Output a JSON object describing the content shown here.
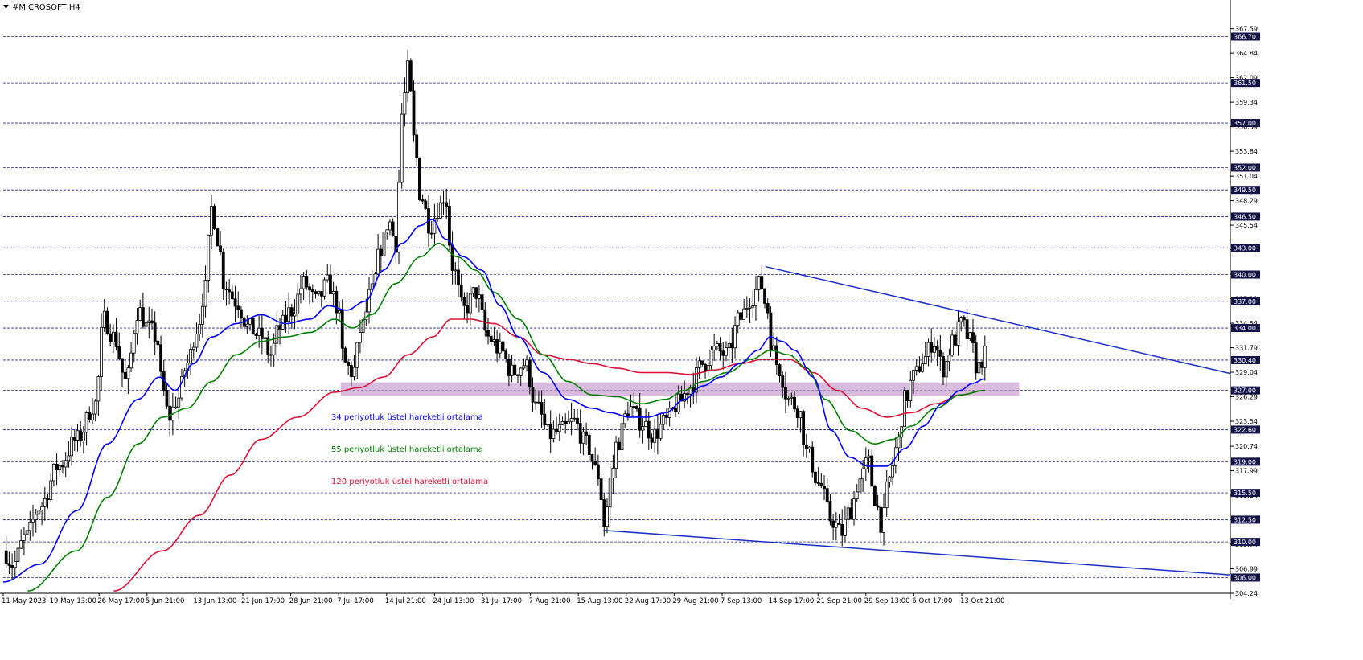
{
  "window": {
    "title": "#MICROSOFT,H4"
  },
  "colors": {
    "ema34": "#0000ff",
    "ema55": "#008000",
    "ema120": "#dd1133",
    "trendline": "#1a2fc8",
    "level": "#24248c",
    "zone": "#c9a0cf",
    "candle": "#000000"
  },
  "chart_data": {
    "type": "line",
    "symbol": "#MICROSOFT",
    "timeframe": "H4",
    "ylim": [
      304.24,
      369.0
    ],
    "price_ticks": [
      "367.59",
      "364.84",
      "362.09",
      "359.34",
      "356.59",
      "353.84",
      "351.04",
      "348.29",
      "345.54",
      "342.79",
      "340.04",
      "337.29",
      "334.54",
      "331.79",
      "329.04",
      "326.29",
      "323.54",
      "320.74",
      "317.99",
      "315.24",
      "312.49",
      "309.74",
      "306.99",
      "304.24"
    ],
    "levels": [
      366.7,
      361.5,
      357.0,
      352.0,
      349.5,
      346.5,
      343.0,
      340.0,
      337.0,
      334.0,
      330.4,
      327.0,
      322.6,
      319.0,
      315.5,
      312.5,
      310.0,
      306.0
    ],
    "level_labels": [
      "366.70",
      "361.50",
      "357.00",
      "352.00",
      "349.50",
      "346.50",
      "343.00",
      "340.00",
      "337.00",
      "334.00",
      "330.40",
      "327.00",
      "322.60",
      "319.00",
      "315.50",
      "312.50",
      "310.00",
      "306.00"
    ],
    "time_labels": [
      "11 May 2023",
      "19 May 13:00",
      "26 May 17:00",
      "5 Jun 21:00",
      "13 Jun 13:00",
      "21 Jun 17:00",
      "28 Jun 21:00",
      "7 Jul 17:00",
      "14 Jul 21:00",
      "24 Jul 13:00",
      "31 Jul 17:00",
      "7 Aug 21:00",
      "15 Aug 13:00",
      "22 Aug 17:00",
      "29 Aug 21:00",
      "7 Sep 13:00",
      "14 Sep 17:00",
      "21 Sep 21:00",
      "29 Sep 13:00",
      "6 Oct 17:00",
      "13 Oct 21:00"
    ],
    "support_zone": {
      "from": 326.4,
      "to": 327.9,
      "t_start": 0.275,
      "t_end": 0.828
    },
    "trendlines": [
      {
        "t": [
          0.621,
          1.0
        ],
        "y": [
          340.9,
          328.9
        ]
      },
      {
        "t": [
          0.489,
          1.0
        ],
        "y": [
          311.3,
          306.3
        ]
      }
    ],
    "price_anchors": [
      [
        0.0,
        309.0
      ],
      [
        0.008,
        307.5
      ],
      [
        0.018,
        310.5
      ],
      [
        0.03,
        314.0
      ],
      [
        0.045,
        318.5
      ],
      [
        0.06,
        321.5
      ],
      [
        0.075,
        325.5
      ],
      [
        0.082,
        335.0
      ],
      [
        0.09,
        333.0
      ],
      [
        0.1,
        328.0
      ],
      [
        0.11,
        336.0
      ],
      [
        0.118,
        334.0
      ],
      [
        0.125,
        333.0
      ],
      [
        0.13,
        327.0
      ],
      [
        0.135,
        324.0
      ],
      [
        0.142,
        326.0
      ],
      [
        0.15,
        330.0
      ],
      [
        0.158,
        334.0
      ],
      [
        0.164,
        338.0
      ],
      [
        0.17,
        347.5
      ],
      [
        0.175,
        344.0
      ],
      [
        0.18,
        339.0
      ],
      [
        0.19,
        337.0
      ],
      [
        0.2,
        334.0
      ],
      [
        0.21,
        333.0
      ],
      [
        0.218,
        331.0
      ],
      [
        0.225,
        334.0
      ],
      [
        0.235,
        336.0
      ],
      [
        0.245,
        339.0
      ],
      [
        0.255,
        337.0
      ],
      [
        0.265,
        339.0
      ],
      [
        0.272,
        336.5
      ],
      [
        0.278,
        330.0
      ],
      [
        0.285,
        329.0
      ],
      [
        0.292,
        334.0
      ],
      [
        0.3,
        338.0
      ],
      [
        0.308,
        343.0
      ],
      [
        0.314,
        346.0
      ],
      [
        0.32,
        343.5
      ],
      [
        0.325,
        358.0
      ],
      [
        0.33,
        363.0
      ],
      [
        0.335,
        355.0
      ],
      [
        0.34,
        349.0
      ],
      [
        0.348,
        345.5
      ],
      [
        0.355,
        347.5
      ],
      [
        0.36,
        349.0
      ],
      [
        0.366,
        341.0
      ],
      [
        0.375,
        336.0
      ],
      [
        0.385,
        338.0
      ],
      [
        0.395,
        333.0
      ],
      [
        0.405,
        331.5
      ],
      [
        0.415,
        329.0
      ],
      [
        0.425,
        330.0
      ],
      [
        0.435,
        325.0
      ],
      [
        0.445,
        322.0
      ],
      [
        0.455,
        322.5
      ],
      [
        0.465,
        323.5
      ],
      [
        0.475,
        321.0
      ],
      [
        0.485,
        317.5
      ],
      [
        0.49,
        312.0
      ],
      [
        0.495,
        317.0
      ],
      [
        0.5,
        321.0
      ],
      [
        0.51,
        325.0
      ],
      [
        0.52,
        323.5
      ],
      [
        0.53,
        322.0
      ],
      [
        0.54,
        323.5
      ],
      [
        0.55,
        325.5
      ],
      [
        0.56,
        327.5
      ],
      [
        0.57,
        330.0
      ],
      [
        0.58,
        331.5
      ],
      [
        0.59,
        331.0
      ],
      [
        0.6,
        335.0
      ],
      [
        0.61,
        337.5
      ],
      [
        0.617,
        339.0
      ],
      [
        0.622,
        336.5
      ],
      [
        0.627,
        331.5
      ],
      [
        0.632,
        329.5
      ],
      [
        0.64,
        326.0
      ],
      [
        0.648,
        325.0
      ],
      [
        0.655,
        320.0
      ],
      [
        0.665,
        316.5
      ],
      [
        0.675,
        312.5
      ],
      [
        0.683,
        311.0
      ],
      [
        0.69,
        313.5
      ],
      [
        0.698,
        317.0
      ],
      [
        0.705,
        319.0
      ],
      [
        0.71,
        315.0
      ],
      [
        0.716,
        312.0
      ],
      [
        0.722,
        317.0
      ],
      [
        0.728,
        320.5
      ],
      [
        0.735,
        326.0
      ],
      [
        0.742,
        328.5
      ],
      [
        0.75,
        330.5
      ],
      [
        0.758,
        332.5
      ],
      [
        0.766,
        329.5
      ],
      [
        0.774,
        332.5
      ],
      [
        0.781,
        334.5
      ],
      [
        0.788,
        332.5
      ],
      [
        0.794,
        329.5
      ],
      [
        0.8,
        331.0
      ]
    ],
    "ema_anchors": {
      "ema34": [
        [
          0.0,
          305.5
        ],
        [
          0.03,
          307.5
        ],
        [
          0.06,
          313.5
        ],
        [
          0.085,
          321.0
        ],
        [
          0.11,
          326.0
        ],
        [
          0.127,
          328.5
        ],
        [
          0.14,
          327.0
        ],
        [
          0.155,
          330.0
        ],
        [
          0.17,
          333.0
        ],
        [
          0.19,
          334.5
        ],
        [
          0.21,
          335.5
        ],
        [
          0.23,
          334.5
        ],
        [
          0.25,
          335.0
        ],
        [
          0.265,
          336.5
        ],
        [
          0.28,
          336.0
        ],
        [
          0.295,
          337.0
        ],
        [
          0.31,
          340.5
        ],
        [
          0.325,
          343.5
        ],
        [
          0.34,
          345.5
        ],
        [
          0.35,
          346.2
        ],
        [
          0.36,
          344.0
        ],
        [
          0.375,
          342.0
        ],
        [
          0.39,
          340.5
        ],
        [
          0.405,
          336.5
        ],
        [
          0.42,
          333.0
        ],
        [
          0.44,
          329.0
        ],
        [
          0.46,
          326.0
        ],
        [
          0.48,
          325.0
        ],
        [
          0.495,
          324.5
        ],
        [
          0.51,
          324.0
        ],
        [
          0.525,
          324.0
        ],
        [
          0.54,
          324.5
        ],
        [
          0.555,
          326.0
        ],
        [
          0.57,
          327.5
        ],
        [
          0.585,
          328.5
        ],
        [
          0.6,
          330.0
        ],
        [
          0.615,
          331.5
        ],
        [
          0.625,
          333.0
        ],
        [
          0.635,
          332.5
        ],
        [
          0.645,
          331.5
        ],
        [
          0.66,
          328.5
        ],
        [
          0.675,
          322.5
        ],
        [
          0.69,
          319.5
        ],
        [
          0.705,
          318.5
        ],
        [
          0.72,
          318.5
        ],
        [
          0.735,
          320.5
        ],
        [
          0.75,
          323.0
        ],
        [
          0.765,
          325.5
        ],
        [
          0.78,
          327.0
        ],
        [
          0.79,
          327.8
        ],
        [
          0.8,
          328.3
        ]
      ],
      "ema55": [
        [
          0.02,
          304.5
        ],
        [
          0.06,
          309.0
        ],
        [
          0.085,
          315.0
        ],
        [
          0.11,
          321.0
        ],
        [
          0.13,
          324.0
        ],
        [
          0.15,
          325.0
        ],
        [
          0.17,
          328.0
        ],
        [
          0.19,
          331.0
        ],
        [
          0.21,
          332.5
        ],
        [
          0.23,
          333.0
        ],
        [
          0.25,
          333.5
        ],
        [
          0.27,
          335.0
        ],
        [
          0.285,
          334.0
        ],
        [
          0.3,
          335.5
        ],
        [
          0.32,
          339.0
        ],
        [
          0.34,
          342.0
        ],
        [
          0.355,
          343.5
        ],
        [
          0.37,
          342.0
        ],
        [
          0.385,
          340.5
        ],
        [
          0.4,
          338.0
        ],
        [
          0.42,
          335.0
        ],
        [
          0.44,
          331.0
        ],
        [
          0.46,
          328.0
        ],
        [
          0.48,
          326.5
        ],
        [
          0.5,
          326.3
        ],
        [
          0.52,
          325.5
        ],
        [
          0.54,
          326.0
        ],
        [
          0.555,
          327.0
        ],
        [
          0.57,
          328.0
        ],
        [
          0.59,
          329.0
        ],
        [
          0.61,
          330.5
        ],
        [
          0.625,
          331.5
        ],
        [
          0.64,
          331.0
        ],
        [
          0.655,
          329.5
        ],
        [
          0.67,
          326.0
        ],
        [
          0.69,
          322.5
        ],
        [
          0.71,
          321.0
        ],
        [
          0.725,
          321.5
        ],
        [
          0.74,
          323.0
        ],
        [
          0.76,
          325.0
        ],
        [
          0.78,
          326.5
        ],
        [
          0.8,
          327.0
        ]
      ],
      "ema120": [
        [
          0.09,
          304.5
        ],
        [
          0.13,
          309.0
        ],
        [
          0.16,
          313.0
        ],
        [
          0.185,
          317.5
        ],
        [
          0.21,
          321.5
        ],
        [
          0.24,
          324.0
        ],
        [
          0.27,
          326.8
        ],
        [
          0.29,
          327.3
        ],
        [
          0.31,
          328.5
        ],
        [
          0.33,
          331.0
        ],
        [
          0.35,
          333.0
        ],
        [
          0.365,
          335.0
        ],
        [
          0.38,
          335.0
        ],
        [
          0.4,
          334.5
        ],
        [
          0.42,
          333.0
        ],
        [
          0.44,
          331.0
        ],
        [
          0.46,
          330.5
        ],
        [
          0.48,
          330.0
        ],
        [
          0.5,
          329.5
        ],
        [
          0.52,
          329.0
        ],
        [
          0.54,
          329.0
        ],
        [
          0.56,
          328.8
        ],
        [
          0.58,
          329.3
        ],
        [
          0.6,
          330.0
        ],
        [
          0.62,
          330.5
        ],
        [
          0.64,
          330.5
        ],
        [
          0.66,
          329.0
        ],
        [
          0.68,
          327.0
        ],
        [
          0.7,
          325.0
        ],
        [
          0.72,
          324.0
        ],
        [
          0.74,
          324.5
        ],
        [
          0.76,
          325.5
        ],
        [
          0.78,
          326.5
        ],
        [
          0.8,
          327.0
        ]
      ]
    },
    "annotations": [
      {
        "text": "34 periyotluk üstel hareketli ortalama",
        "color_key": "ema34"
      },
      {
        "text": "55 periyotluk üstel hareketli ortalama",
        "color_key": "ema55"
      },
      {
        "text": "120 periyotluk üstel hareketli ortalama",
        "color_key": "ema120"
      }
    ],
    "grid": false
  }
}
